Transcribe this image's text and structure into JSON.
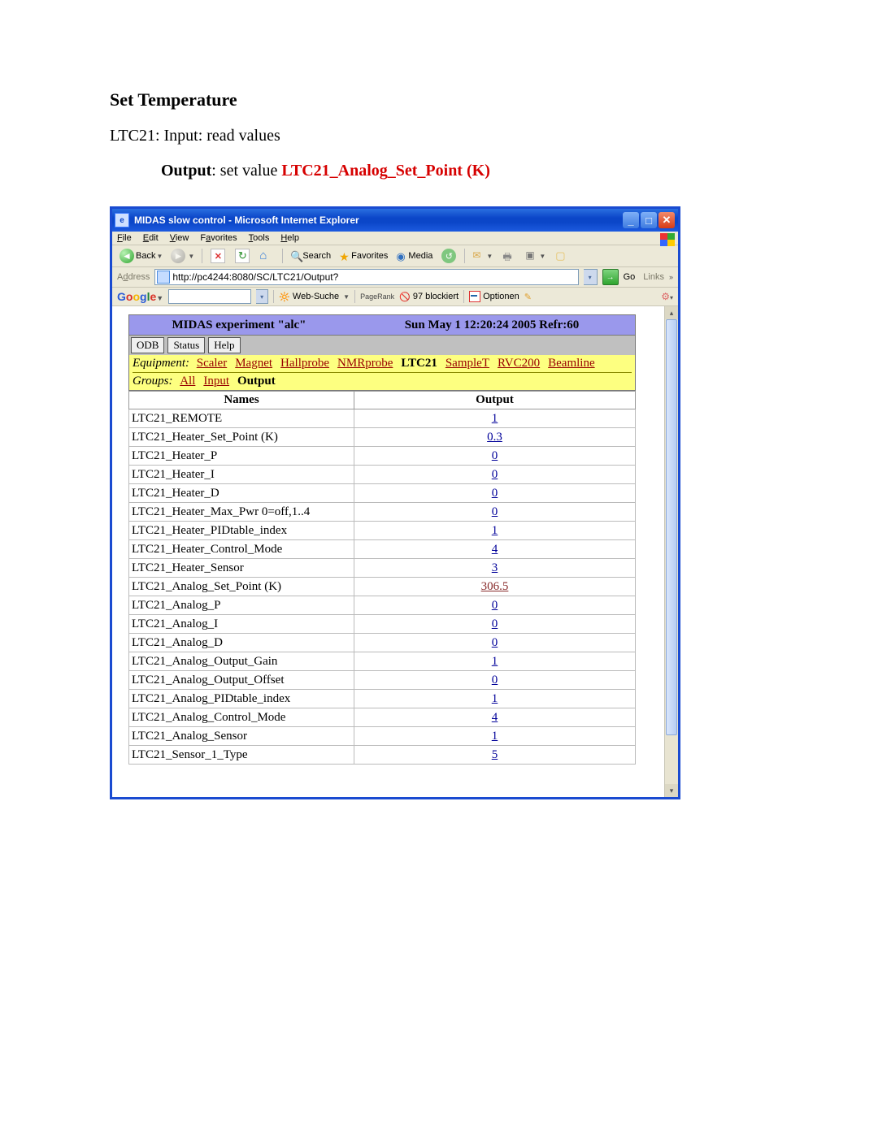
{
  "doc": {
    "heading": "Set Temperature",
    "line1": "LTC21: Input: read values",
    "output_label": "Output",
    "set_value_text": ": set value ",
    "red_text": "LTC21_Analog_Set_Point (K)"
  },
  "window": {
    "title": "MIDAS slow control - Microsoft Internet Explorer"
  },
  "menubar": {
    "file": "File",
    "edit": "Edit",
    "view": "View",
    "favorites": "Favorites",
    "tools": "Tools",
    "help": "Help"
  },
  "toolbar": {
    "back": "Back",
    "search": "Search",
    "favorites": "Favorites",
    "media": "Media"
  },
  "addressbar": {
    "label": "Address",
    "url": "http://pc4244:8080/SC/LTC21/Output?",
    "go": "Go",
    "links": "Links"
  },
  "googlebar": {
    "websuche": "Web-Suche",
    "pagerank": "PageRank",
    "blocked": "97 blockiert",
    "optionen": "Optionen"
  },
  "midas": {
    "title_left": "MIDAS experiment \"alc\"",
    "title_right": "Sun May 1 12:20:24 2005   Refr:60",
    "buttons": {
      "odb": "ODB",
      "status": "Status",
      "help": "Help"
    },
    "equip_label": "Equipment:",
    "equipment": [
      "Scaler",
      "Magnet",
      "Hallprobe",
      "NMRprobe",
      "LTC21",
      "SampleT",
      "RVC200",
      "Beamline"
    ],
    "equipment_active": "LTC21",
    "groups_label": "Groups:",
    "groups": [
      "All",
      "Input",
      "Output"
    ],
    "groups_active": "Output",
    "col_names": "Names",
    "col_output": "Output",
    "rows": [
      {
        "name": "LTC21_REMOTE",
        "value": "1"
      },
      {
        "name": "LTC21_Heater_Set_Point (K)",
        "value": "0.3"
      },
      {
        "name": "LTC21_Heater_P",
        "value": "0"
      },
      {
        "name": "LTC21_Heater_I",
        "value": "0"
      },
      {
        "name": "LTC21_Heater_D",
        "value": "0"
      },
      {
        "name": "LTC21_Heater_Max_Pwr 0=off,1..4",
        "value": "0"
      },
      {
        "name": "LTC21_Heater_PIDtable_index",
        "value": "1"
      },
      {
        "name": "LTC21_Heater_Control_Mode",
        "value": "4"
      },
      {
        "name": "LTC21_Heater_Sensor",
        "value": "3"
      },
      {
        "name": "LTC21_Analog_Set_Point (K)",
        "value": "306.5",
        "highlight": true
      },
      {
        "name": "LTC21_Analog_P",
        "value": "0"
      },
      {
        "name": "LTC21_Analog_I",
        "value": "0"
      },
      {
        "name": "LTC21_Analog_D",
        "value": "0"
      },
      {
        "name": "LTC21_Analog_Output_Gain",
        "value": "1"
      },
      {
        "name": "LTC21_Analog_Output_Offset",
        "value": "0"
      },
      {
        "name": "LTC21_Analog_PIDtable_index",
        "value": "1"
      },
      {
        "name": "LTC21_Analog_Control_Mode",
        "value": "4"
      },
      {
        "name": "LTC21_Analog_Sensor",
        "value": "1"
      },
      {
        "name": "LTC21_Sensor_1_Type",
        "value": "5"
      }
    ]
  }
}
